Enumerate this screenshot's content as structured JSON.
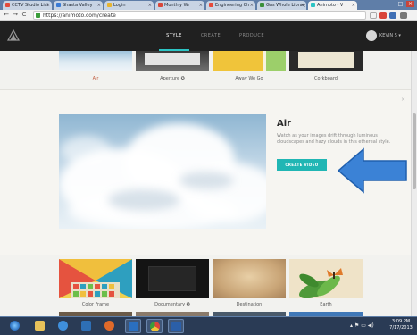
{
  "browser": {
    "tabs": [
      {
        "label": "CCTV Studio List"
      },
      {
        "label": "Shasta Valley"
      },
      {
        "label": "Login"
      },
      {
        "label": "Monthly Wr"
      },
      {
        "label": "Engineering Ch"
      },
      {
        "label": "Gas Whole Library"
      },
      {
        "label": "Animoto - V"
      }
    ],
    "url": "https://animoto.com/create",
    "controls": {
      "back": "←",
      "forward": "→",
      "reload": "C",
      "minimize": "–",
      "maximize": "□",
      "close": "×"
    }
  },
  "app": {
    "nav_tabs": [
      {
        "label": "STYLE",
        "active": true
      },
      {
        "label": "CREATE",
        "active": false
      },
      {
        "label": "PRODUCE",
        "active": false
      }
    ],
    "user_name": "KEVIN S ▾"
  },
  "styles_top_row": [
    {
      "label": "Air",
      "selected": true
    },
    {
      "label": "Aperture ✪",
      "selected": false
    },
    {
      "label": "Away We Go",
      "selected": false
    },
    {
      "label": "Corkboard",
      "selected": false
    }
  ],
  "selected_panel": {
    "title": "Air",
    "description": "Watch as your images drift through luminous cloudscapes and hazy clouds in this ethereal style.",
    "button_label": "CREATE VIDEO",
    "close_glyph": "×"
  },
  "styles_bottom_row": [
    {
      "label": "Color Frame"
    },
    {
      "label": "Documentary ✪"
    },
    {
      "label": "Destination"
    },
    {
      "label": "Earth"
    }
  ],
  "taskbar": {
    "clock_time": "3:09 PM",
    "clock_date": "7/17/2013",
    "tray": "▴  ⚑  ▭  ◀)"
  },
  "colors": {
    "accent": "#20b6b4",
    "header_bg": "#202020",
    "annotation_arrow": "#3b82d6"
  }
}
